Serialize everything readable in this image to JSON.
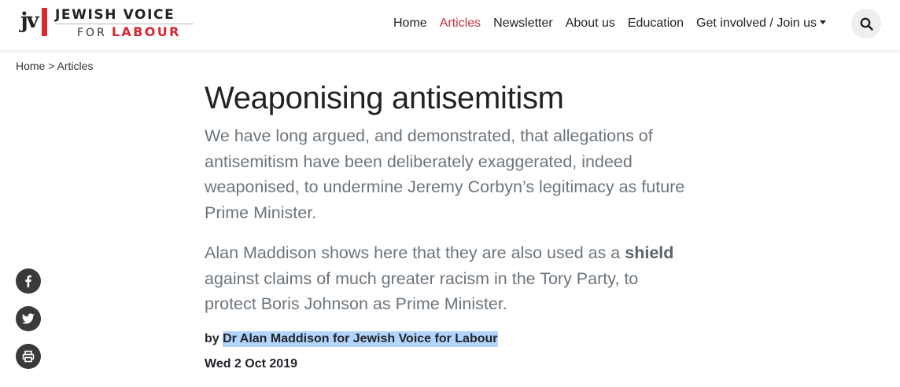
{
  "site": {
    "logo_mark": "jv",
    "logo_line1": "JEWISH VOICE",
    "logo_for": "FOR",
    "logo_labour": "LABOUR"
  },
  "nav": {
    "items": [
      {
        "label": "Home",
        "active": false
      },
      {
        "label": "Articles",
        "active": true
      },
      {
        "label": "Newsletter",
        "active": false
      },
      {
        "label": "About us",
        "active": false
      },
      {
        "label": "Education",
        "active": false
      },
      {
        "label": "Get involved / Join us",
        "active": false
      }
    ],
    "search_icon": "search-icon"
  },
  "breadcrumb": {
    "home": "Home",
    "separator": " > ",
    "current": "Articles"
  },
  "article": {
    "title": "Weaponising antisemitism",
    "lead1": "We have long argued, and demonstrated, that allegations of antisemitism have been deliberately exaggerated, indeed weaponised, to undermine Jeremy Corbyn’s legitimacy as future Prime Minister.",
    "lead2_before": "Alan Maddison shows here that they are also used as a ",
    "lead2_bold": "shield",
    "lead2_after": " against claims of much greater racism in the Tory Party, to protect Boris Johnson as Prime Minister.",
    "by_prefix": "by ",
    "author": "Dr Alan Maddison for Jewish Voice for Labour",
    "date": "Wed 2 Oct 2019"
  },
  "share": {
    "icons": [
      "facebook-icon",
      "twitter-icon",
      "print-icon"
    ]
  },
  "colors": {
    "brand_red": "#d9262f",
    "nav_active": "#c5343c",
    "lead_text": "#6c757d",
    "selection_highlight": "#b3d4fc",
    "share_bg": "#3a3a3a"
  }
}
